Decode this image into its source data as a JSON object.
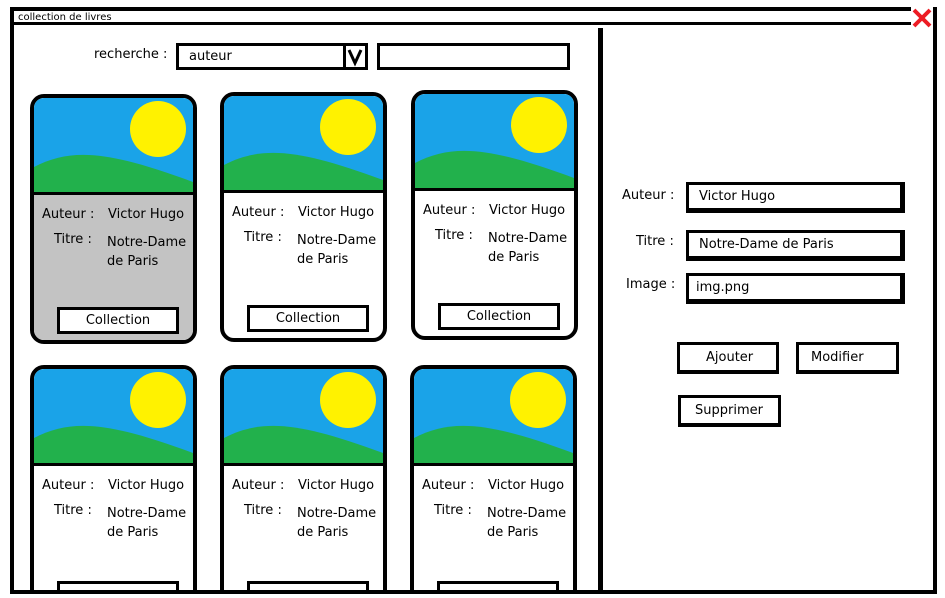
{
  "window": {
    "title": "collection de livres"
  },
  "search": {
    "label": "recherche :",
    "selected_field": "auteur",
    "query": ""
  },
  "cards": [
    {
      "author_label": "Auteur :",
      "author": "Victor Hugo",
      "title_label": "Titre :",
      "title_line1": "Notre-Dame",
      "title_line2": "de Paris",
      "button": "Collection"
    },
    {
      "author_label": "Auteur :",
      "author": "Victor Hugo",
      "title_label": "Titre :",
      "title_line1": "Notre-Dame",
      "title_line2": "de Paris",
      "button": "Collection"
    },
    {
      "author_label": "Auteur :",
      "author": "Victor Hugo",
      "title_label": "Titre :",
      "title_line1": "Notre-Dame",
      "title_line2": "de Paris",
      "button": "Collection"
    },
    {
      "author_label": "Auteur :",
      "author": "Victor Hugo",
      "title_label": "Titre :",
      "title_line1": "Notre-Dame",
      "title_line2": "de Paris",
      "button": ""
    },
    {
      "author_label": "Auteur :",
      "author": "Victor Hugo",
      "title_label": "Titre :",
      "title_line1": "Notre-Dame",
      "title_line2": "de Paris",
      "button": ""
    },
    {
      "author_label": "Auteur :",
      "author": "Victor Hugo",
      "title_label": "Titre :",
      "title_line1": "Notre-Dame",
      "title_line2": "de Paris",
      "button": ""
    }
  ],
  "form": {
    "author_label": "Auteur :",
    "author_value": "Victor Hugo",
    "title_label": "Titre :",
    "title_value": "Notre-Dame de Paris",
    "image_label": "Image :",
    "image_value": "img.png",
    "add_button": "Ajouter",
    "edit_button": "Modifier",
    "delete_button": "Supprimer"
  },
  "colors": {
    "sky": "#1aa3e8",
    "sun": "#fff200",
    "grass": "#22b14c",
    "selected_card": "#c3c3c3",
    "close_icon": "#ed1c24"
  }
}
